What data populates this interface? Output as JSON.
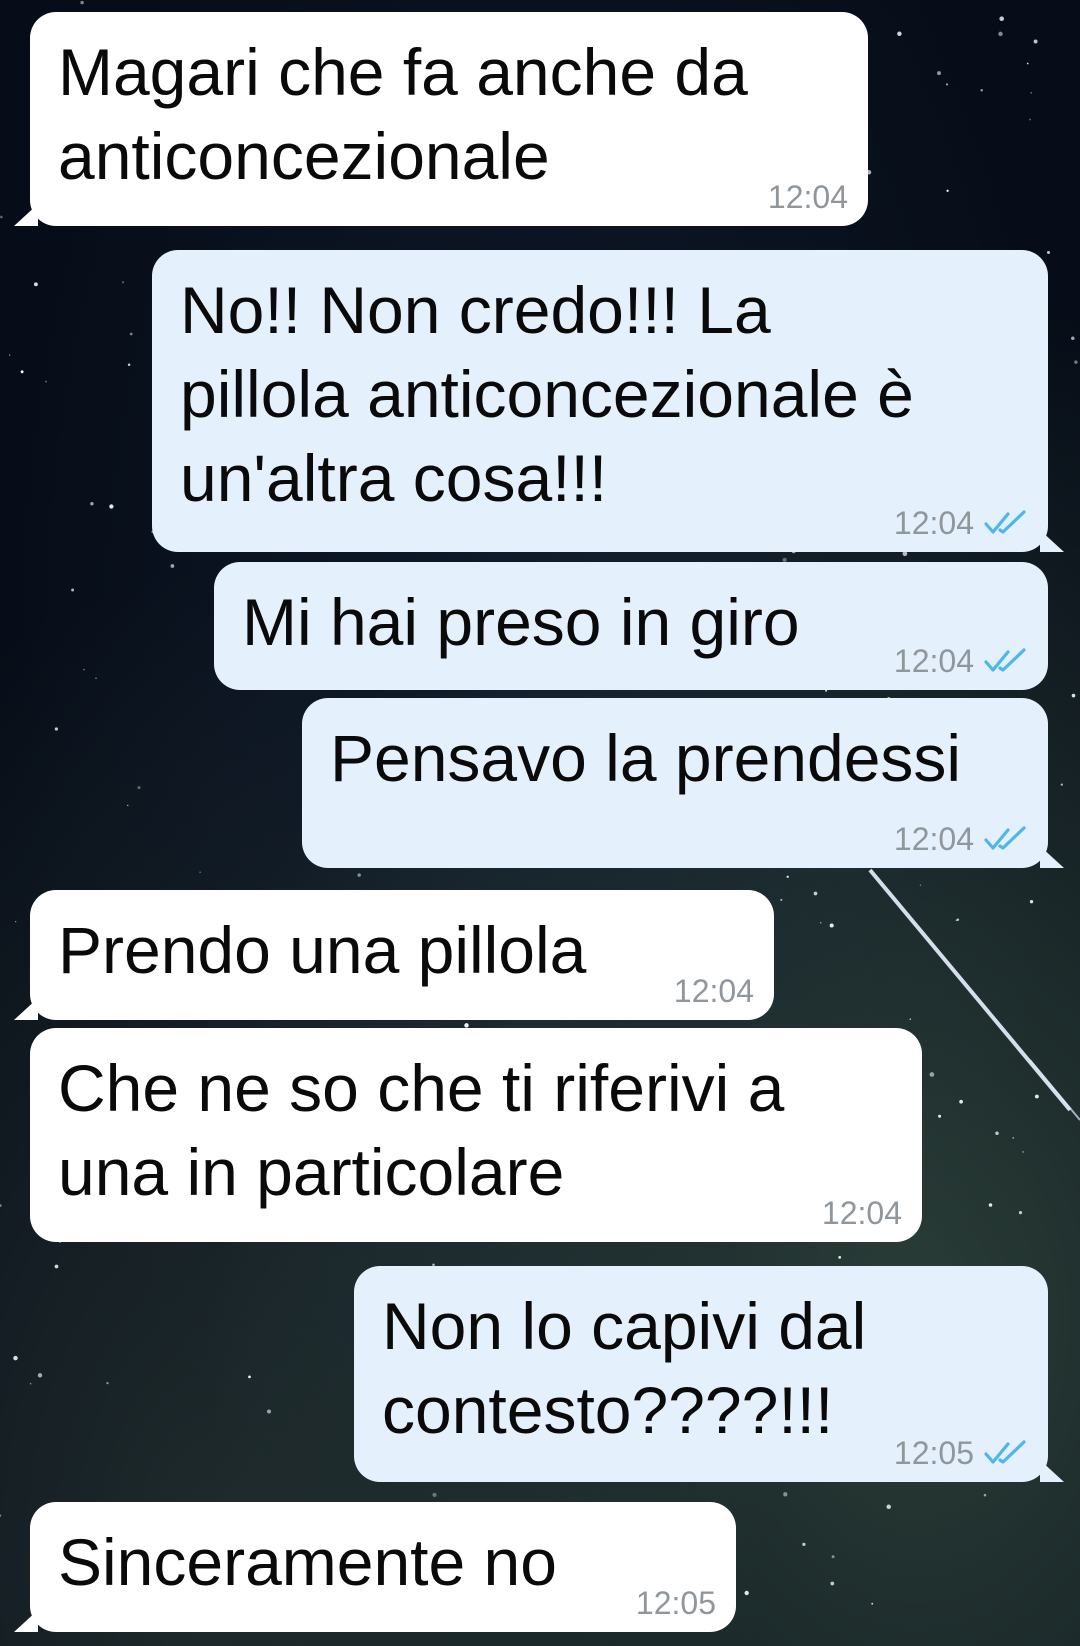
{
  "messages": [
    {
      "text": "Magari che fa anche da\nanticoncezionale",
      "time": "12:04",
      "from": "them"
    },
    {
      "text": "No!! Non credo!!! La\npillola anticoncezionale è\nun'altra cosa!!!",
      "time": "12:04",
      "from": "me",
      "status": "read-double-check-icon"
    },
    {
      "text": "Mi hai preso in giro",
      "time": "12:04",
      "from": "me",
      "status": "read-double-check-icon"
    },
    {
      "text": "Pensavo la prendessi",
      "time": "12:04",
      "from": "me",
      "status": "read-double-check-icon"
    },
    {
      "text": "Prendo una pillola",
      "time": "12:04",
      "from": "them"
    },
    {
      "text": "Che ne so che ti riferivi a\nuna in particolare",
      "time": "12:04",
      "from": "them"
    },
    {
      "text": "Non lo capivi dal\ncontesto????!!!",
      "time": "12:05",
      "from": "me",
      "status": "read-double-check-icon"
    },
    {
      "text": "Sinceramente no",
      "time": "12:05",
      "from": "them"
    }
  ],
  "colors": {
    "incoming_bubble": "#ffffff",
    "outgoing_bubble": "#e4f0fb",
    "timestamp": "#8f969c",
    "read_ticks": "#4fb6ec"
  }
}
